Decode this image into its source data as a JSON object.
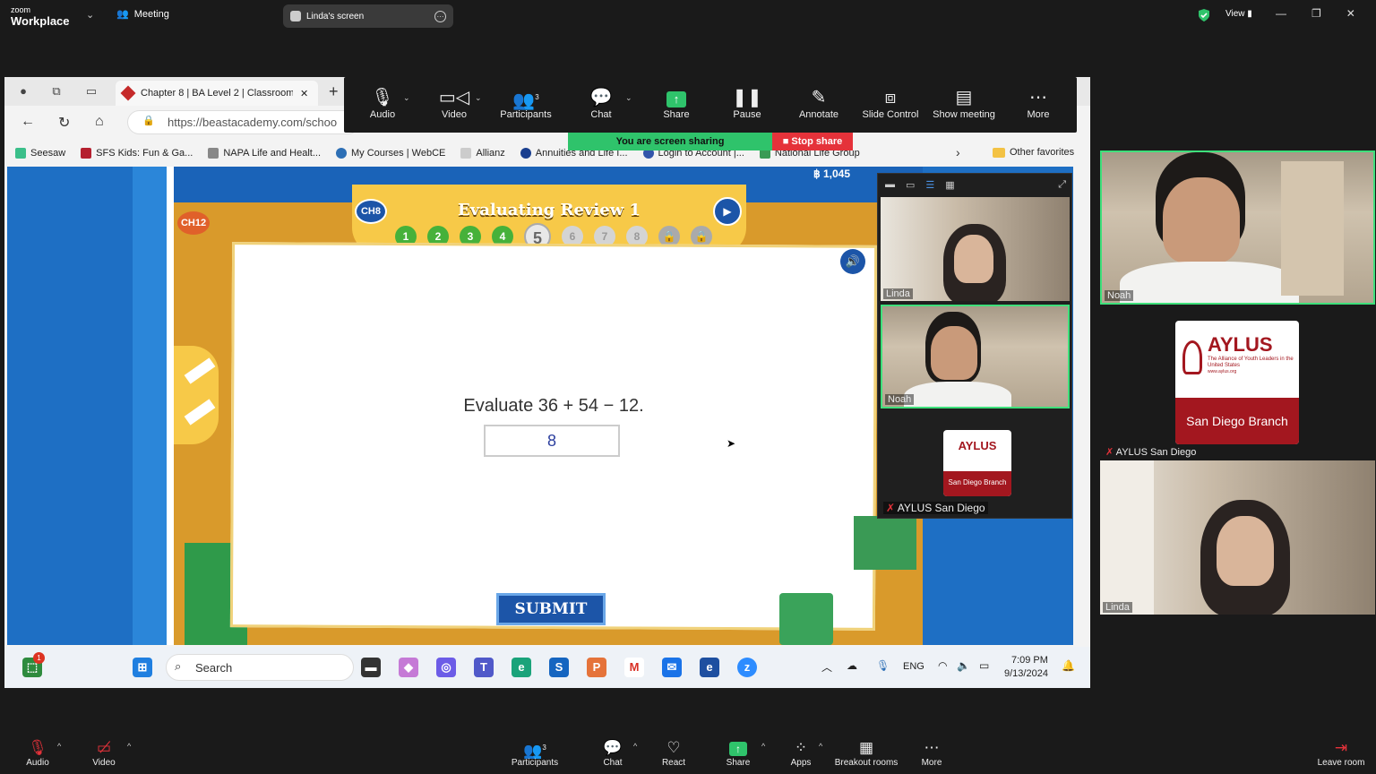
{
  "zoom": {
    "logo_line1": "zoom",
    "logo_line2": "Workplace",
    "meeting_label": "Meeting",
    "share_tab_title": "Linda's screen",
    "view_label": "View",
    "toolbar": [
      {
        "label": "Audio",
        "icon": "microphone-icon"
      },
      {
        "label": "Video",
        "icon": "video-camera-icon"
      },
      {
        "label": "Participants",
        "icon": "participants-icon",
        "count": "3"
      },
      {
        "label": "Chat",
        "icon": "chat-icon"
      },
      {
        "label": "Share",
        "icon": "share-icon"
      },
      {
        "label": "Pause",
        "icon": "pause-icon"
      },
      {
        "label": "Annotate",
        "icon": "pencil-icon"
      },
      {
        "label": "Slide Control",
        "icon": "slide-control-icon"
      },
      {
        "label": "Show meeting",
        "icon": "window-icon"
      },
      {
        "label": "More",
        "icon": "ellipsis-icon"
      }
    ],
    "sharing_status": "You are screen sharing",
    "stop_share": "Stop share",
    "floating_videos": [
      {
        "name": "Linda"
      },
      {
        "name": "Noah"
      },
      {
        "name": "AYLUS San Diego"
      }
    ],
    "gallery": [
      {
        "name": "Noah"
      },
      {
        "name": "AYLUS San Diego"
      },
      {
        "name": "Linda"
      }
    ],
    "aylus_logo": {
      "title": "AYLUS",
      "tagline": "The Alliance of Youth Leaders in the United States",
      "motto": "Leadership Integrity Innovation",
      "url": "www.aylus.org",
      "branch": "San Diego Branch"
    },
    "bottom_bar": [
      {
        "label": "Audio"
      },
      {
        "label": "Video"
      },
      {
        "label": "Participants",
        "count": "3"
      },
      {
        "label": "Chat"
      },
      {
        "label": "React"
      },
      {
        "label": "Share"
      },
      {
        "label": "Apps"
      },
      {
        "label": "Breakout rooms"
      },
      {
        "label": "More"
      },
      {
        "label": "Leave room"
      }
    ],
    "accent_green": "#2fc36b",
    "accent_red": "#e5323a"
  },
  "browser": {
    "active_tab": "Chapter 8 | BA Level 2 | Classroom",
    "url": "https://beastacademy.com/schoo",
    "favorites": [
      {
        "label": "Seesaw",
        "color": "#3bbf8a"
      },
      {
        "label": "SFS Kids: Fun & Ga...",
        "color": "#b5202f"
      },
      {
        "label": "NAPA Life and Healt...",
        "color": "#888888"
      },
      {
        "label": "My Courses | WebCE",
        "color": "#2d6fb5"
      },
      {
        "label": "Allianz",
        "color": "#cccccc"
      },
      {
        "label": "Annuities and Life I...",
        "color": "#1a3f8f"
      },
      {
        "label": "Login to Account |...",
        "color": "#3355aa"
      },
      {
        "label": "National Life Group",
        "color": "#3a9a55"
      }
    ],
    "other_favorites": "Other favorites"
  },
  "beast_academy": {
    "chapter_badge": "CH8",
    "side_badge": "CH12",
    "title": "Evaluating Review 1",
    "coins": "฿ 1,045",
    "steps": [
      "1",
      "2",
      "3",
      "4",
      "5",
      "6",
      "7",
      "8"
    ],
    "question": "Evaluate 36 + 54 − 12.",
    "answer": "8",
    "submit": "SUBMIT"
  },
  "taskbar": {
    "search": "Search",
    "notification_count": "1",
    "lang": "ENG",
    "time": "7:09 PM",
    "date": "9/13/2024"
  }
}
